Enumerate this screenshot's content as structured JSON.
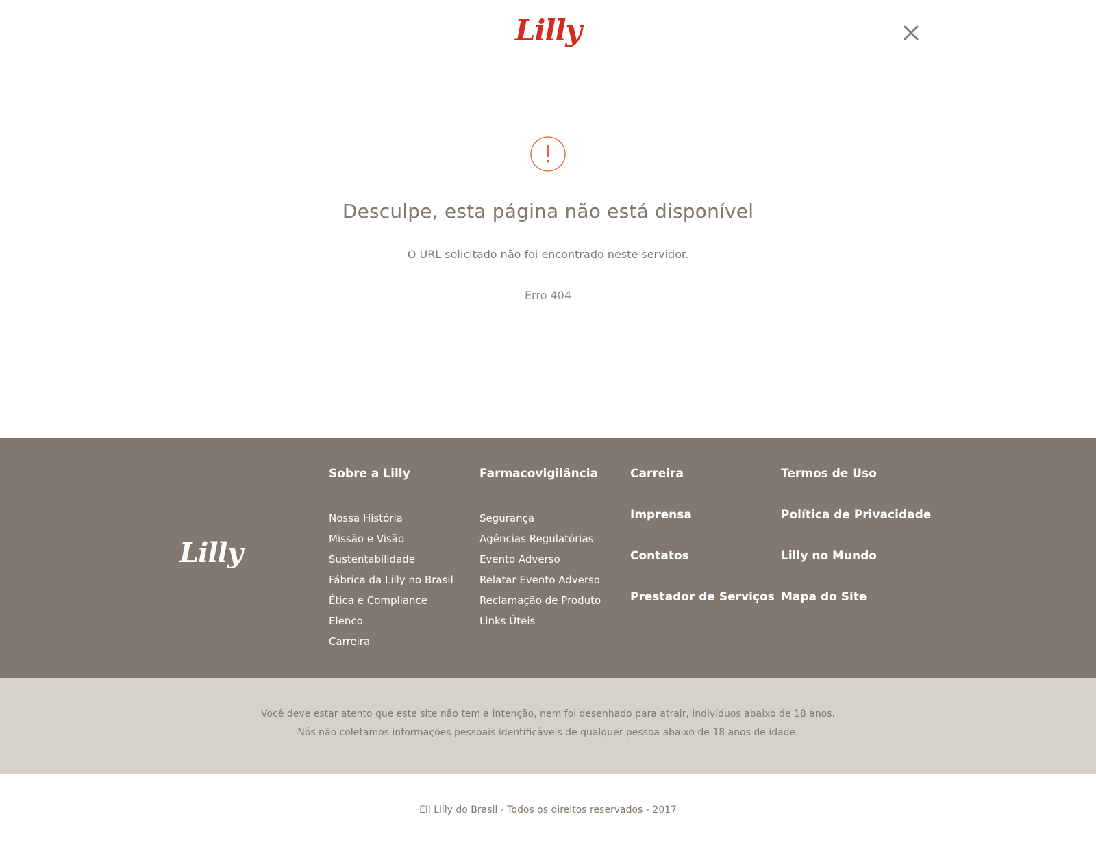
{
  "header": {
    "logo_text": "Lilly",
    "close_icon": "close-icon"
  },
  "error": {
    "icon": "alert-circle-icon",
    "title": "Desculpe, esta página não está disponível",
    "message": "O URL  solicitado não foi encontrado neste servidor.",
    "code": "Erro 404"
  },
  "footer": {
    "logo_text": "Lilly",
    "columns": [
      {
        "heading": "Sobre a Lilly",
        "links": [
          "Nossa História",
          "Missão e Visão",
          "Sustentabilidade",
          "Fábrica da Lilly no Brasil",
          "Ética e Compliance",
          "Elenco",
          "Carreira"
        ]
      },
      {
        "heading": "Farmacovigilância",
        "links": [
          "Segurança",
          "Agências Regulatórias",
          "Evento Adverso",
          "Relatar Evento Adverso",
          "Reclamação de Produto",
          "Links Úteis"
        ]
      },
      {
        "headings": [
          "Carreira",
          "Imprensa",
          "Contatos",
          "Prestador de Serviços"
        ]
      },
      {
        "headings": [
          "Termos de Uso",
          "Política de Privacidade",
          "Lilly no Mundo",
          "Mapa do Site"
        ]
      }
    ]
  },
  "disclaimer": {
    "line1": "Você deve estar atento que este site não tem a intenção, nem foi desenhado para atrair, indivíduos abaixo de 18 anos.",
    "line2": "Nós não coletamos informações pessoais identificáveis de qualquer pessoa abaixo de 18 anos de idade."
  },
  "copyright": "Eli Lilly do Brasil - Todos os direitos reservados - 2017",
  "colors": {
    "brand_red": "#d52b1e",
    "accent_orange": "#e8632b",
    "footer_bg": "#82786f",
    "disclaimer_bg": "#d5d2cc",
    "text_gray": "#817870"
  }
}
